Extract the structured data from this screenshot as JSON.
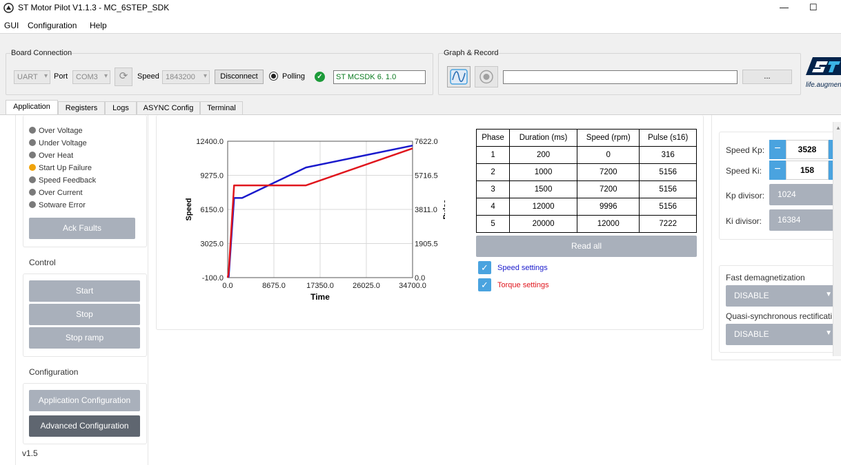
{
  "window": {
    "title": "ST Motor Pilot V1.1.3 - MC_6STEP_SDK",
    "minimize": "—",
    "maximize": "☐"
  },
  "menu": [
    "GUI",
    "Configuration",
    "Help"
  ],
  "board_connection": {
    "title": "Board Connection",
    "interface": "UART",
    "port_label": "Port",
    "port": "COM3",
    "speed_label": "Speed",
    "speed": "1843200",
    "disconnect": "Disconnect",
    "polling": "Polling",
    "firmware": "ST MCSDK 6. 1.0"
  },
  "graph_record": {
    "title": "Graph & Record",
    "path": "",
    "browse": "..."
  },
  "logo": {
    "text": "life.augmented"
  },
  "tabs": [
    "Application",
    "Registers",
    "Logs",
    "ASYNC Config",
    "Terminal"
  ],
  "faults": {
    "items": [
      {
        "label": "Over Voltage",
        "state": "off"
      },
      {
        "label": "Under Voltage",
        "state": "off"
      },
      {
        "label": "Over Heat",
        "state": "off"
      },
      {
        "label": "Start Up Failure",
        "state": "warn"
      },
      {
        "label": "Speed Feedback",
        "state": "off"
      },
      {
        "label": "Over Current",
        "state": "off"
      },
      {
        "label": "Sotware Error",
        "state": "off"
      }
    ],
    "ack": "Ack Faults"
  },
  "control": {
    "title": "Control",
    "start": "Start",
    "stop": "Stop",
    "stop_ramp": "Stop ramp"
  },
  "configuration": {
    "title": "Configuration",
    "app_config": "Application Configuration",
    "adv_config": "Advanced Configuration"
  },
  "version": "v1.5",
  "chart_data": {
    "type": "line",
    "xlabel": "Time",
    "ylabel": "Speed",
    "y2label": "Pulse",
    "xlim": [
      0.0,
      34700.0
    ],
    "ylim": [
      -100.0,
      12400.0
    ],
    "y2lim": [
      0.0,
      7622.0
    ],
    "x_ticks": [
      "0.0",
      "8675.0",
      "17350.0",
      "26025.0",
      "34700.0"
    ],
    "y_ticks": [
      "-100.0",
      "3025.0",
      "6150.0",
      "9275.0",
      "12400.0"
    ],
    "y2_ticks": [
      "0.0",
      "1905.5",
      "3811.0",
      "5716.5",
      "7622.0"
    ],
    "grid": true,
    "series": [
      {
        "axis": "left",
        "color": "#1a1acc",
        "x": [
          0,
          200,
          1200,
          2700,
          14700,
          34700
        ],
        "y": [
          0,
          0,
          7200,
          7200,
          9996,
          12000
        ]
      },
      {
        "axis": "right",
        "color": "#e0161d",
        "x": [
          0,
          200,
          1200,
          2700,
          14700,
          34700
        ],
        "y": [
          0,
          316,
          5156,
          5156,
          5156,
          7222
        ]
      }
    ]
  },
  "phase_table": {
    "headers": [
      "Phase",
      "Duration (ms)",
      "Speed (rpm)",
      "Pulse (s16)"
    ],
    "rows": [
      [
        "1",
        "200",
        "0",
        "316"
      ],
      [
        "2",
        "1000",
        "7200",
        "5156"
      ],
      [
        "3",
        "1500",
        "7200",
        "5156"
      ],
      [
        "4",
        "12000",
        "9996",
        "5156"
      ],
      [
        "5",
        "20000",
        "12000",
        "7222"
      ]
    ],
    "read_all": "Read all",
    "speed_settings": "Speed settings",
    "torque_settings": "Torque settings"
  },
  "speed_regulator": {
    "kp_label": "Speed Kp:",
    "kp": "3528",
    "ki_label": "Speed Ki:",
    "ki": "158",
    "kp_div_label": "Kp divisor:",
    "kp_div": "1024",
    "ki_div_label": "Ki divisor:",
    "ki_div": "16384"
  },
  "demag": {
    "fast_label": "Fast demagnetization",
    "fast": "DISABLE",
    "quasi_label": "Quasi-synchronous rectificati",
    "quasi": "DISABLE"
  },
  "colors": {
    "accent": "#4aa3df",
    "button_gray": "#a9b0bb",
    "button_dark": "#5f6670",
    "st_blue": "#03234b"
  }
}
